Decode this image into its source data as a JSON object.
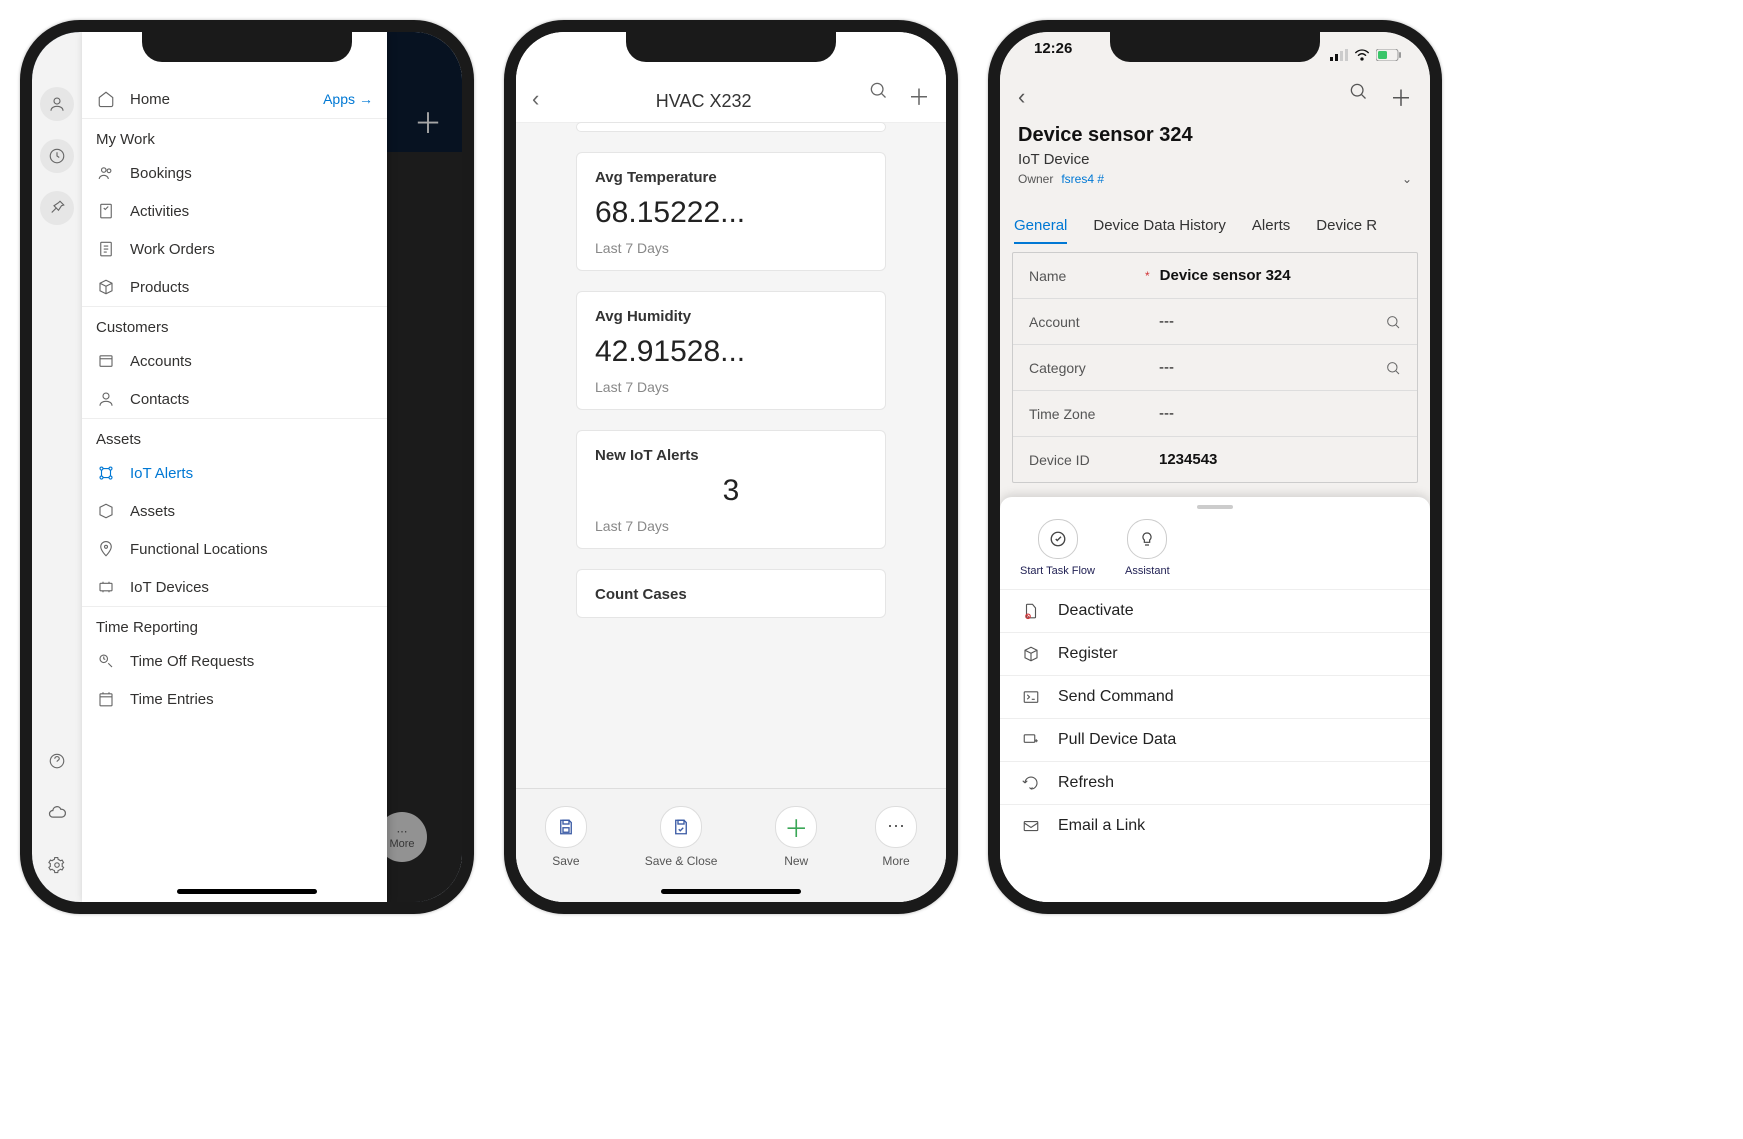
{
  "phone1": {
    "home": "Home",
    "apps_link": "Apps",
    "more_btn": "More",
    "sections": {
      "my_work": "My Work",
      "customers": "Customers",
      "assets": "Assets",
      "time_reporting": "Time Reporting"
    },
    "items": {
      "bookings": "Bookings",
      "activities": "Activities",
      "work_orders": "Work Orders",
      "products": "Products",
      "accounts": "Accounts",
      "contacts": "Contacts",
      "iot_alerts": "IoT Alerts",
      "assets_item": "Assets",
      "functional_locations": "Functional Locations",
      "iot_devices": "IoT Devices",
      "time_off_requests": "Time Off Requests",
      "time_entries": "Time Entries"
    }
  },
  "phone2": {
    "title": "HVAC X232",
    "cards": {
      "avg_temp": {
        "label": "Avg Temperature",
        "value": "68.15222...",
        "sub": "Last 7 Days"
      },
      "avg_humidity": {
        "label": "Avg Humidity",
        "value": "42.91528...",
        "sub": "Last 7 Days"
      },
      "new_alerts": {
        "label": "New IoT Alerts",
        "value": "3",
        "sub": "Last 7 Days"
      },
      "count_cases": {
        "label": "Count Cases"
      }
    },
    "bottom": {
      "save": "Save",
      "save_close": "Save & Close",
      "new": "New",
      "more": "More"
    }
  },
  "phone3": {
    "status_time": "12:26",
    "title": "Device sensor 324",
    "subtitle": "IoT Device",
    "owner_label": "Owner",
    "owner_value": "fsres4 #",
    "tabs": {
      "general": "General",
      "device_data_history": "Device Data History",
      "alerts": "Alerts",
      "device_r": "Device R"
    },
    "fields": {
      "name": {
        "label": "Name",
        "value": "Device sensor 324"
      },
      "account": {
        "label": "Account",
        "value": "---"
      },
      "category": {
        "label": "Category",
        "value": "---"
      },
      "time_zone": {
        "label": "Time Zone",
        "value": "---"
      },
      "device_id": {
        "label": "Device ID",
        "value": "1234543"
      }
    },
    "panel_top": {
      "start_task_flow": "Start Task Flow",
      "assistant": "Assistant"
    },
    "actions": {
      "deactivate": "Deactivate",
      "register": "Register",
      "send_command": "Send Command",
      "pull_device_data": "Pull Device Data",
      "refresh": "Refresh",
      "email_link": "Email a Link"
    }
  }
}
